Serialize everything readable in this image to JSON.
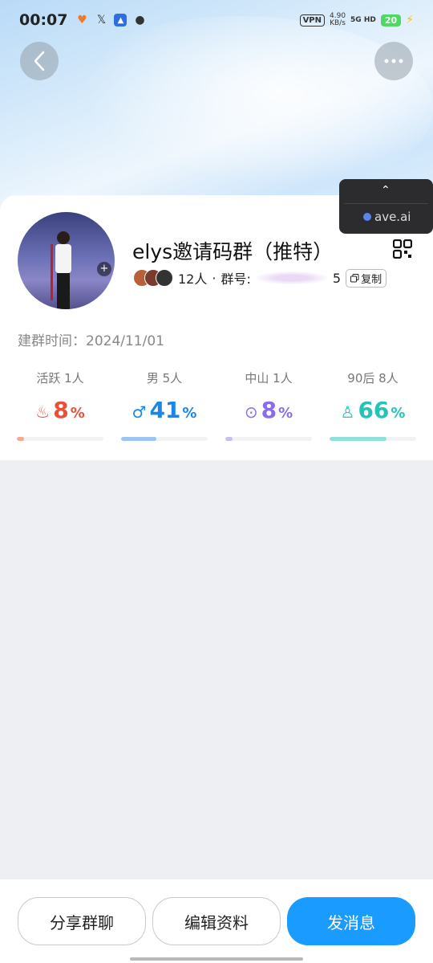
{
  "status_bar": {
    "time": "00:07",
    "vpn": "VPN",
    "net_speed": "4.90",
    "net_unit": "KB/s",
    "signal": "5G HD",
    "battery": "20",
    "icons": [
      "heart-icon",
      "x-icon",
      "app-icon",
      "wechat-icon"
    ]
  },
  "popup": {
    "site": "ave.ai"
  },
  "group": {
    "name": "elys邀请码群（推特）",
    "member_count": "12人",
    "separator": "·",
    "id_label": "群号:",
    "id_tail": "5",
    "copy_label": "复制",
    "created_label": "建群时间：",
    "created_date": "2024/11/01"
  },
  "stats": [
    {
      "label": "活跃 1人",
      "value": "8",
      "unit": "%",
      "icon": "flame-icon",
      "color": "#e8503a",
      "bar_color": "#f4a897",
      "fraction": 0.08
    },
    {
      "label": "男 5人",
      "value": "41",
      "unit": "%",
      "icon": "male-icon",
      "color": "#1a86e8",
      "bar_color": "#9dc5f3",
      "fraction": 0.41
    },
    {
      "label": "中山 1人",
      "value": "8",
      "unit": "%",
      "icon": "location-icon",
      "color": "#8a6de8",
      "bar_color": "#c9bdf3",
      "fraction": 0.08
    },
    {
      "label": "90后 8人",
      "value": "66",
      "unit": "%",
      "icon": "person-icon",
      "color": "#22c3b8",
      "bar_color": "#8fe0d9",
      "fraction": 0.66
    }
  ],
  "actions": {
    "share": "分享群聊",
    "edit": "编辑资料",
    "send": "发消息"
  }
}
